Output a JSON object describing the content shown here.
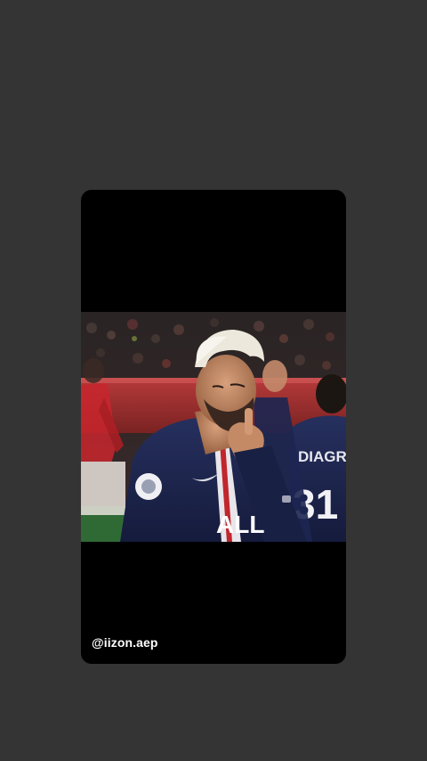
{
  "story": {
    "username": "@iizon.aep"
  },
  "media": {
    "jersey_sponsor": "ALL",
    "player_back_name": "DIAGRA",
    "player_back_number": "31",
    "background_color": "#343434",
    "card_color": "#000000",
    "kit_color": "#1a2350",
    "opponent_kit_color": "#c8262d"
  }
}
